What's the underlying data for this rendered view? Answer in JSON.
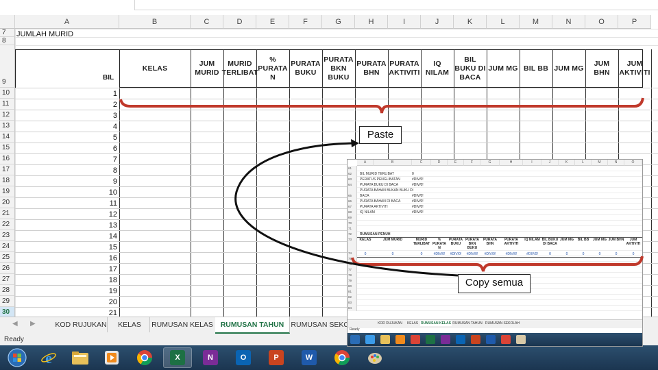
{
  "spreadsheet": {
    "columns": [
      "A",
      "B",
      "C",
      "D",
      "E",
      "F",
      "G",
      "H",
      "I",
      "J",
      "K",
      "L",
      "M",
      "N",
      "O",
      "P"
    ],
    "rows": [
      "7",
      "8",
      "9",
      "10",
      "11",
      "12",
      "13",
      "14",
      "15",
      "16",
      "17",
      "18",
      "19",
      "20",
      "21",
      "22",
      "23",
      "24",
      "25",
      "26",
      "27",
      "28",
      "29",
      "30"
    ],
    "selected_row": "30",
    "a7_text": "JUMLAH MURID",
    "bil_header": "BIL",
    "headers": [
      "KELAS",
      "JUM MURID",
      "MURID TERLIBAT",
      "% PURATA N",
      "PURATA BUKU",
      "PURATA BKN BUKU",
      "PURATA BHN",
      "PURATA AKTIVITI",
      "IQ NILAM",
      "BIL BUKU DI BACA",
      "JUM MG",
      "BIL BB",
      "JUM MG",
      "JUM BHN",
      "JUM AKTIVITI"
    ],
    "bil_numbers": [
      "1",
      "2",
      "3",
      "4",
      "5",
      "6",
      "7",
      "8",
      "9",
      "10",
      "11",
      "12",
      "13",
      "14",
      "15",
      "16",
      "17",
      "18",
      "19",
      "20",
      "21"
    ]
  },
  "sheet_tabs": [
    "KOD RUJUKAN",
    "KELAS",
    "RUMUSAN KELAS",
    "RUMUSAN TAHUN",
    "RUMUSAN SEKO"
  ],
  "active_tab": "RUMUSAN TAHUN",
  "status": "Ready",
  "annotations": {
    "paste_label": "Paste",
    "copy_label": "Copy semua",
    "bracket_color": "#c0392b"
  },
  "inset": {
    "columns": [
      "A",
      "B",
      "C",
      "D",
      "E",
      "F",
      "G",
      "H",
      "I",
      "J",
      "K",
      "L",
      "M",
      "N",
      "O"
    ],
    "rows": [
      "61",
      "62",
      "63",
      "64",
      "",
      "65",
      "66",
      "67",
      "68",
      "69",
      "70",
      "71",
      "72",
      "73",
      "74",
      "75",
      "76",
      "77",
      "78",
      "79",
      "80",
      "81",
      "82",
      "83",
      "84"
    ],
    "list_items": [
      "BIL MURID TERLIBAT",
      "PERATUS PENGLIBATAN",
      "PURATA BUKU DI BACA",
      "PURATA BAHAN BUKAN BUKU DI",
      "BACA",
      "PURATA BAHAN DI BACA",
      "PURATA AKTIVITI",
      "IQ NILAM"
    ],
    "list_values": [
      "0",
      "#DIV/0!",
      "#DIV/0!",
      "",
      "#DIV/0!",
      "#DIV/0!",
      "#DIV/0!",
      "#DIV/0!"
    ],
    "section_title": "RUMUSAN PENUH",
    "headers": [
      "KELAS",
      "JUM MURID",
      "MURID TERLIBAT",
      "% PURATA N",
      "PURATA BUKU",
      "PURATA BKN BUKU",
      "PURATA BHN",
      "PURATA AKTIVITI",
      "IQ NILAM",
      "BIL BUKU DI BACA",
      "JUM MG",
      "BIL BB",
      "JUM MG",
      "JUM BHN",
      "JUM AKTIVITI"
    ],
    "data_row": [
      "0",
      "0",
      "0",
      "#DIV/0!",
      "#DIV/0!",
      "#DIV/0!",
      "#DIV/0!",
      "#DIV/0!",
      "#DIV/0!",
      "0",
      "0",
      "0",
      "0",
      "0",
      "0"
    ],
    "tabs": [
      "KOD RUJUKAN",
      "KELAS",
      "RUMUSAN KELAS",
      "RUMUSAN TAHUN",
      "RUMUSAN SEKOLAH"
    ],
    "active_tab": "RUMUSAN KELAS",
    "status": "Ready"
  },
  "taskbar": {
    "icons": [
      "start-orb-icon",
      "internet-explorer-icon",
      "file-explorer-icon",
      "media-player-icon",
      "chrome-icon",
      "excel-icon",
      "onenote-icon",
      "outlook-icon",
      "powerpoint-icon",
      "word-icon",
      "chrome-icon",
      "paint-icon"
    ],
    "letters": {
      "excel": "X",
      "onenote": "N",
      "outlook": "O",
      "powerpoint": "P",
      "word": "W"
    }
  }
}
